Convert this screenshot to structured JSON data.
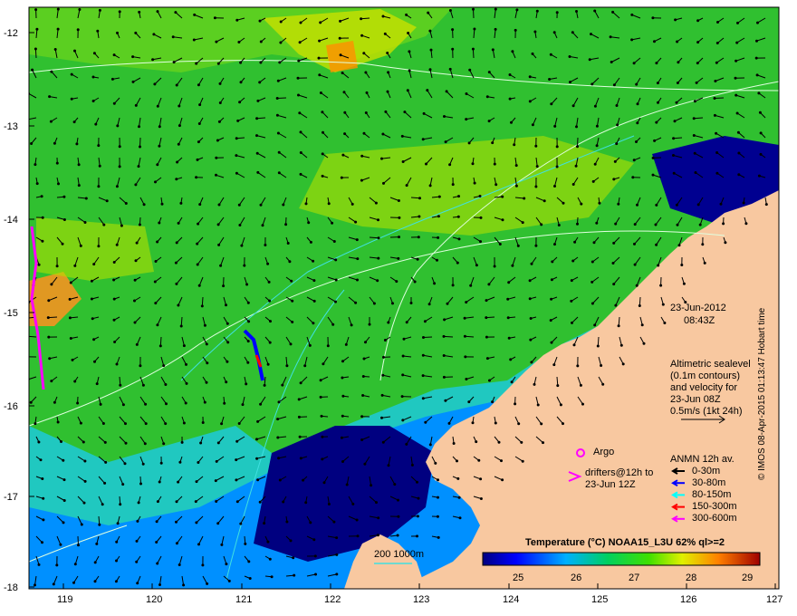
{
  "map": {
    "date": "23-Jun-2012",
    "time": "08:43Z",
    "lat_ticks": [
      "-12",
      "-13",
      "-14",
      "-15",
      "-16",
      "-17",
      "-18"
    ],
    "lon_ticks": [
      "119",
      "120",
      "121",
      "122",
      "123",
      "124",
      "125",
      "126",
      "127"
    ],
    "altimetry_lines": [
      "Altimetric sealevel",
      "(0.1m contours)",
      "and velocity for",
      "23-Jun 08Z",
      "0.5m/s (1kt 24h)"
    ],
    "argo_label": "Argo",
    "drifters_lines": [
      "drifters@12h to",
      "23-Jun 12Z"
    ],
    "anmn": {
      "title": "ANMN 12h av.",
      "items": [
        {
          "label": "0-30m",
          "color": "#000000"
        },
        {
          "label": "30-80m",
          "color": "#0000ff"
        },
        {
          "label": "80-150m",
          "color": "#00ffff"
        },
        {
          "label": "150-300m",
          "color": "#ff0000"
        },
        {
          "label": "300-600m",
          "color": "#ff00ff"
        }
      ]
    },
    "depth_contours_label": "200  1000m",
    "colorbar": {
      "title": "Temperature (°C) NOAA15_L3U 62% ql>=2",
      "ticks": [
        "25",
        "26",
        "27",
        "28",
        "29"
      ]
    },
    "credit": "© IMOS 08-Apr-2015 01:13:47 Hobart time",
    "colors": {
      "land": "#f8c8a0",
      "deep": "#000080",
      "blue": "#0050ff",
      "cyan": "#20c8ff",
      "green": "#20c820",
      "yellow": "#c8e800",
      "orange": "#ff8000",
      "contour": "#e0ffe0",
      "bathy": "#40e0e0"
    }
  }
}
